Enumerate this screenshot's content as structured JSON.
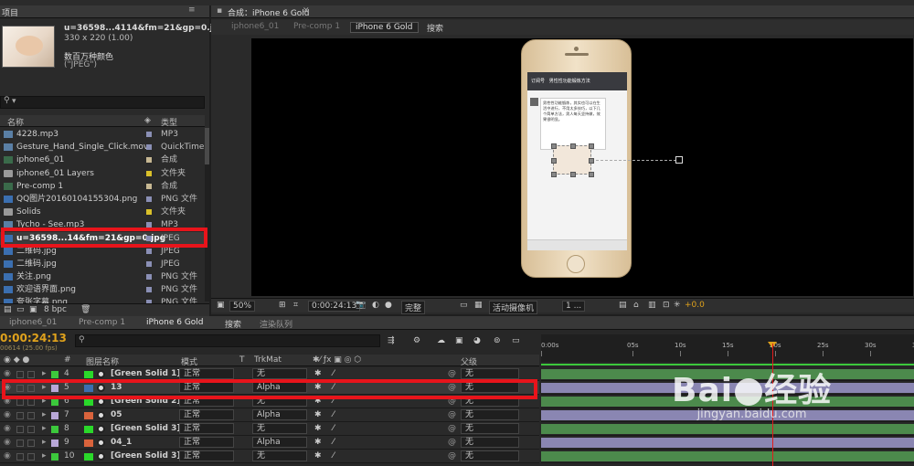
{
  "project": {
    "tab_title": "项目",
    "file_name": "u=36598...4114&fm=21&gp=0.jpg",
    "file_size": "330 x 220 (1.00)",
    "color_info": "数百万种颜色",
    "format": "(\"JPEG\")",
    "columns": {
      "name": "名称",
      "type": "类型"
    },
    "items": [
      {
        "name": "4228.mp3",
        "type": "MP3",
        "label_color": "#8a8fb5",
        "icon": "audio-icon"
      },
      {
        "name": "Gesture_Hand_Single_Click.mov",
        "type": "QuickTime",
        "label_color": "#8a8fb5",
        "icon": "video-icon"
      },
      {
        "name": "iphone6_01",
        "type": "合成",
        "label_color": "#c7b893",
        "icon": "comp-icon"
      },
      {
        "name": "iphone6_01 Layers",
        "type": "文件夹",
        "label_color": "#d9c02a",
        "icon": "folder-icon"
      },
      {
        "name": "Pre-comp 1",
        "type": "合成",
        "label_color": "#c7b893",
        "icon": "comp-icon"
      },
      {
        "name": "QQ图片20160104155304.png",
        "type": "PNG 文件",
        "label_color": "#8a8fb5",
        "icon": "image-icon"
      },
      {
        "name": "Solids",
        "type": "文件夹",
        "label_color": "#d9c02a",
        "icon": "folder-icon"
      },
      {
        "name": "Tycho - See.mp3",
        "type": "MP3",
        "label_color": "#8a8fb5",
        "icon": "audio-icon"
      },
      {
        "name": "u=36598...14&fm=21&gp=0.jpg",
        "type": "JPEG",
        "label_color": "#8a8fb5",
        "icon": "image-icon",
        "selected": true
      },
      {
        "name": "二维码.jpg",
        "type": "JPEG",
        "label_color": "#8a8fb5",
        "icon": "image-icon"
      },
      {
        "name": "二维码.jpg",
        "type": "JPEG",
        "label_color": "#8a8fb5",
        "icon": "image-icon"
      },
      {
        "name": "关注.png",
        "type": "PNG 文件",
        "label_color": "#8a8fb5",
        "icon": "image-icon"
      },
      {
        "name": "欢迎语界面.png",
        "type": "PNG 文件",
        "label_color": "#8a8fb5",
        "icon": "image-icon"
      },
      {
        "name": "夸张字幕.png",
        "type": "PNG 文件",
        "label_color": "#8a8fb5",
        "icon": "image-icon"
      }
    ],
    "footer_bpc": "8 bpc"
  },
  "composition": {
    "tab_title": "合成：iPhone 6 Gold",
    "subtabs": [
      "iphone6_01",
      "Pre-comp 1",
      "iPhone 6 Gold",
      "搜索"
    ],
    "active_subtab": "iPhone 6 Gold",
    "phone_header": "男性性功能锻炼方法",
    "phone_back": "订阅号",
    "message_text": "男性性功能锻炼，其实也可以在生活中进行，不用太多技巧，以下几个简单方法，男人每天坚持做，效果很明显。",
    "footer": {
      "zoom": "50%",
      "timecode": "0:00:24:13",
      "resolution": "完整",
      "camera": "活动摄像机",
      "views": "1 ...",
      "exposure": "+0.0"
    }
  },
  "timeline": {
    "tabs": [
      "iphone6_01",
      "Pre-comp 1",
      "iPhone 6 Gold",
      "搜索",
      "渲染队列"
    ],
    "active_tab": "iPhone 6 Gold",
    "timecode": "0:00:24:13",
    "fps": "00614 (25.00 fps)",
    "columns": {
      "num": "#",
      "name": "图层名称",
      "mode": "模式",
      "t": "T",
      "trkmat": "TrkMat",
      "parent": "父级"
    },
    "ruler_labels": [
      "0:00s",
      "05s",
      "10s",
      "15s",
      "20s",
      "25s",
      "30s",
      "35s"
    ],
    "layers": [
      {
        "num": "4",
        "name": "[Green Solid 1]",
        "mode": "正常",
        "trkmat": "无",
        "parent": "无",
        "label_color": "#3cc83c",
        "swatch": "#2ad82a",
        "bar": "#4c8a4c"
      },
      {
        "num": "5",
        "name": "13",
        "mode": "正常",
        "trkmat": "Alpha",
        "parent": "无",
        "label_color": "#b9a8d8",
        "swatch": "#3b6fb0",
        "bar": "#8a86b2",
        "selected": true
      },
      {
        "num": "6",
        "name": "[Green Solid 2]",
        "mode": "正常",
        "trkmat": "无",
        "parent": "无",
        "label_color": "#3cc83c",
        "swatch": "#2ad82a",
        "bar": "#4c8a4c"
      },
      {
        "num": "7",
        "name": "05",
        "mode": "正常",
        "trkmat": "Alpha",
        "parent": "无",
        "label_color": "#b9a8d8",
        "swatch": "#d9633c",
        "bar": "#8a86b2"
      },
      {
        "num": "8",
        "name": "[Green Solid 3]",
        "mode": "正常",
        "trkmat": "无",
        "parent": "无",
        "label_color": "#3cc83c",
        "swatch": "#2ad82a",
        "bar": "#4c8a4c"
      },
      {
        "num": "9",
        "name": "04_1",
        "mode": "正常",
        "trkmat": "Alpha",
        "parent": "无",
        "label_color": "#b9a8d8",
        "swatch": "#d9633c",
        "bar": "#8a86b2"
      },
      {
        "num": "10",
        "name": "[Green Solid 3]",
        "mode": "正常",
        "trkmat": "无",
        "parent": "无",
        "label_color": "#3cc83c",
        "swatch": "#2ad82a",
        "bar": "#4c8a4c"
      }
    ]
  },
  "watermark": {
    "brand": "Bai",
    "brand2": "经验",
    "url": "jingyan.baidu.com"
  }
}
